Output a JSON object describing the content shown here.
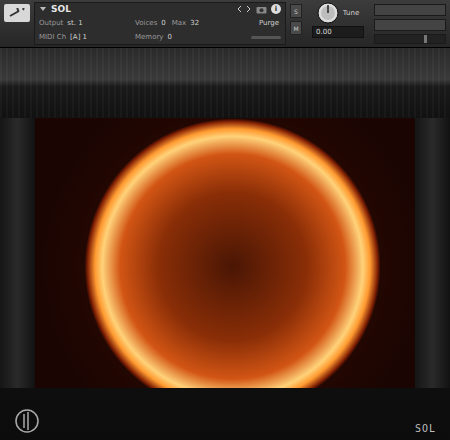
{
  "instrument": {
    "name": "SOL",
    "expanded": true
  },
  "header": {
    "info": "i",
    "fields": [
      {
        "label": "Output",
        "value": "st. 1"
      },
      {
        "label": "Voices",
        "value": "0"
      },
      {
        "label": "Max",
        "value": "32"
      },
      {
        "label": "MIDI Ch",
        "value": "[A] 1"
      },
      {
        "label": "Memory",
        "value": "0"
      }
    ],
    "purge": "Purge"
  },
  "side_buttons": [
    "S",
    "M"
  ],
  "tune": {
    "label": "Tune",
    "value": "0.00"
  },
  "logo": {
    "text": "SOL"
  }
}
